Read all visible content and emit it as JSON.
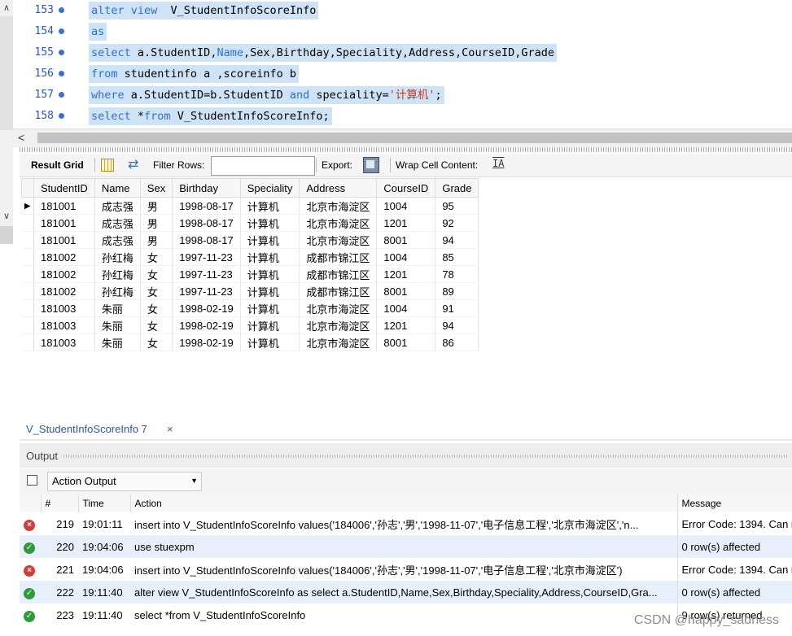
{
  "editor": {
    "lines": [
      {
        "no": "153",
        "parts": [
          {
            "t": "alter view",
            "k": "kw"
          },
          {
            "t": "  V_StudentInfoScoreInfo",
            "k": ""
          }
        ]
      },
      {
        "no": "154",
        "parts": [
          {
            "t": "as",
            "k": "kw"
          }
        ]
      },
      {
        "no": "155",
        "parts": [
          {
            "t": "select",
            "k": "kw"
          },
          {
            "t": " a.StudentID,",
            "k": ""
          },
          {
            "t": "Name",
            "k": "kw"
          },
          {
            "t": ",Sex,Birthday,Speciality,Address,CourseID,Grade",
            "k": ""
          }
        ]
      },
      {
        "no": "156",
        "parts": [
          {
            "t": "from",
            "k": "kw"
          },
          {
            "t": " studentinfo a ,scoreinfo b",
            "k": ""
          }
        ]
      },
      {
        "no": "157",
        "parts": [
          {
            "t": "where",
            "k": "kw"
          },
          {
            "t": " a.StudentID=b.StudentID ",
            "k": ""
          },
          {
            "t": "and",
            "k": "kw"
          },
          {
            "t": " speciality=",
            "k": ""
          },
          {
            "t": "'计算机'",
            "k": "str"
          },
          {
            "t": ";",
            "k": ""
          }
        ]
      },
      {
        "no": "158",
        "parts": [
          {
            "t": "select",
            "k": "kw"
          },
          {
            "t": " *",
            "k": ""
          },
          {
            "t": "from",
            "k": "kw"
          },
          {
            "t": " V_StudentInfoScoreInfo;",
            "k": ""
          }
        ]
      }
    ],
    "scroll_left": "<"
  },
  "result_toolbar": {
    "result_grid": "Result Grid",
    "filter_rows": "Filter Rows:",
    "filter_value": "",
    "export": "Export:",
    "wrap": "Wrap Cell Content:",
    "wrap_icon": "IA"
  },
  "grid": {
    "columns": [
      "StudentID",
      "Name",
      "Sex",
      "Birthday",
      "Speciality",
      "Address",
      "CourseID",
      "Grade"
    ],
    "rows": [
      [
        "181001",
        "成志强",
        "男",
        "1998-08-17",
        "计算机",
        "北京市海淀区",
        "1004",
        "95"
      ],
      [
        "181001",
        "成志强",
        "男",
        "1998-08-17",
        "计算机",
        "北京市海淀区",
        "1201",
        "92"
      ],
      [
        "181001",
        "成志强",
        "男",
        "1998-08-17",
        "计算机",
        "北京市海淀区",
        "8001",
        "94"
      ],
      [
        "181002",
        "孙红梅",
        "女",
        "1997-11-23",
        "计算机",
        "成都市锦江区",
        "1004",
        "85"
      ],
      [
        "181002",
        "孙红梅",
        "女",
        "1997-11-23",
        "计算机",
        "成都市锦江区",
        "1201",
        "78"
      ],
      [
        "181002",
        "孙红梅",
        "女",
        "1997-11-23",
        "计算机",
        "成都市锦江区",
        "8001",
        "89"
      ],
      [
        "181003",
        "朱丽",
        "女",
        "1998-02-19",
        "计算机",
        "北京市海淀区",
        "1004",
        "91"
      ],
      [
        "181003",
        "朱丽",
        "女",
        "1998-02-19",
        "计算机",
        "北京市海淀区",
        "1201",
        "94"
      ],
      [
        "181003",
        "朱丽",
        "女",
        "1998-02-19",
        "计算机",
        "北京市海淀区",
        "8001",
        "86"
      ]
    ]
  },
  "result_tab": {
    "label": "V_StudentInfoScoreInfo 7",
    "close": "×"
  },
  "output": {
    "title": "Output",
    "action_select": "Action Output",
    "columns": {
      "num": "#",
      "time": "Time",
      "action": "Action",
      "message": "Message"
    },
    "rows": [
      {
        "status": "error",
        "num": "219",
        "time": "19:01:11",
        "action": "insert into V_StudentInfoScoreInfo values('184006','孙志','男','1998-11-07','电子信息工程','北京市海淀区','n...",
        "message": "Error Code: 1394. Can n"
      },
      {
        "status": "ok",
        "num": "220",
        "time": "19:04:06",
        "action": "use stuexpm",
        "message": "0 row(s) affected"
      },
      {
        "status": "error",
        "num": "221",
        "time": "19:04:06",
        "action": "insert into V_StudentInfoScoreInfo values('184006','孙志','男','1998-11-07','电子信息工程','北京市海淀区')",
        "message": "Error Code: 1394. Can n"
      },
      {
        "status": "ok",
        "num": "222",
        "time": "19:11:40",
        "action": "alter view  V_StudentInfoScoreInfo as  select a.StudentID,Name,Sex,Birthday,Speciality,Address,CourseID,Gra...",
        "message": "0 row(s) affected"
      },
      {
        "status": "ok",
        "num": "223",
        "time": "19:11:40",
        "action": "select *from V_StudentInfoScoreInfo",
        "message": "9 row(s) returned"
      }
    ]
  },
  "watermark": "CSDN @happy_sadness"
}
